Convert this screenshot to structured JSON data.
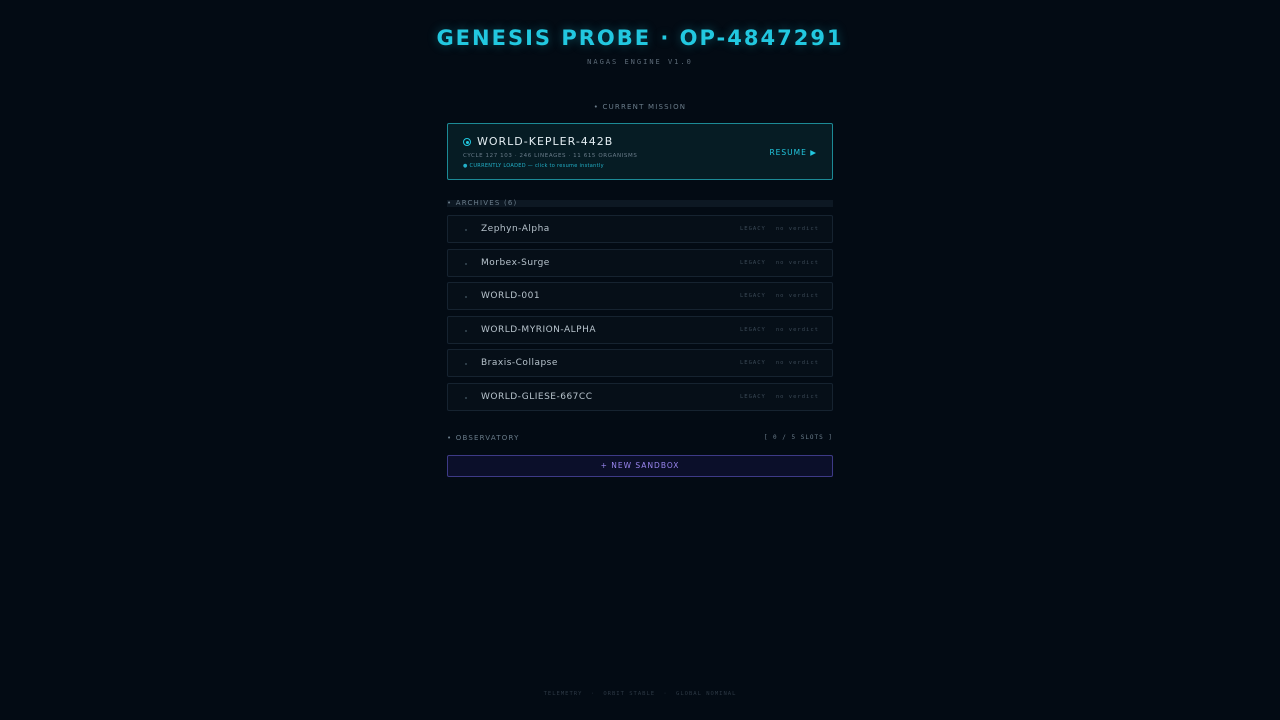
{
  "header": {
    "title": "GENESIS PROBE · OP-4847291",
    "subtitle": "NAGAS ENGINE V1.0"
  },
  "current_mission": {
    "section_label": "• CURRENT MISSION",
    "name": "WORLD-KEPLER-442B",
    "stats": "CYCLE 127 103 · 246 LINEAGES · 11 615 ORGANISMS",
    "note": "● CURRENTLY LOADED — click to resume instantly",
    "resume_label": "RESUME ▶"
  },
  "archives": {
    "section_label": "• ARCHIVES (6)",
    "items": [
      {
        "name": "Zephyn-Alpha",
        "tag": "LEGACY",
        "verdict": "no verdict"
      },
      {
        "name": "Morbex-Surge",
        "tag": "LEGACY",
        "verdict": "no verdict"
      },
      {
        "name": "WORLD-001",
        "tag": "LEGACY",
        "verdict": "no verdict"
      },
      {
        "name": "WORLD-MYRION-ALPHA",
        "tag": "LEGACY",
        "verdict": "no verdict"
      },
      {
        "name": "Braxis-Collapse",
        "tag": "LEGACY",
        "verdict": "no verdict"
      },
      {
        "name": "WORLD-GLIESE-667CC",
        "tag": "LEGACY",
        "verdict": "no verdict"
      }
    ]
  },
  "observatory": {
    "section_label": "• OBSERVATORY",
    "slots": "[ 0 / 5 SLOTS ]",
    "new_sandbox_label": "+ NEW SANDBOX"
  },
  "footer": {
    "links": [
      "TELEMETRY",
      "ORBIT STABLE",
      "GLOBAL NOMINAL"
    ],
    "separator": "·"
  },
  "colors": {
    "accent": "#22c8e0",
    "sandbox_accent": "#9a86f0",
    "background": "#030b14"
  }
}
